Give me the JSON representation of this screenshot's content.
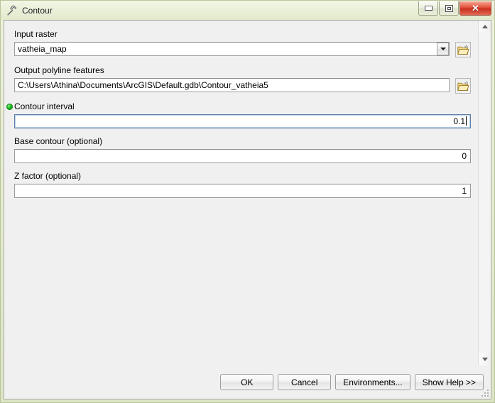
{
  "window": {
    "title": "Contour",
    "title_icon": "hammer-tool-icon",
    "controls": {
      "minimize": "minimize-icon",
      "restore": "restore-icon",
      "close": "✕"
    }
  },
  "form": {
    "fields": [
      {
        "label": "Input raster",
        "value": "vatheia_map",
        "type": "combo",
        "required": false,
        "align": "left",
        "has_browse": true,
        "focused": false
      },
      {
        "label": "Output polyline features",
        "value": "C:\\Users\\Athina\\Documents\\ArcGIS\\Default.gdb\\Contour_vatheia5",
        "type": "text",
        "required": false,
        "align": "left",
        "has_browse": true,
        "focused": false
      },
      {
        "label": "Contour interval",
        "value": "0.1",
        "type": "text",
        "required": true,
        "align": "right",
        "has_browse": false,
        "focused": true
      },
      {
        "label": "Base contour (optional)",
        "value": "0",
        "type": "text",
        "required": false,
        "align": "right",
        "has_browse": false,
        "focused": false
      },
      {
        "label": "Z factor (optional)",
        "value": "1",
        "type": "text",
        "required": false,
        "align": "right",
        "has_browse": false,
        "focused": false
      }
    ]
  },
  "scrollbar": {
    "up_icon": "scroll-up-arrow-icon",
    "down_icon": "scroll-down-arrow-icon"
  },
  "footer": {
    "buttons": [
      {
        "label": "OK"
      },
      {
        "label": "Cancel"
      },
      {
        "label": "Environments..."
      },
      {
        "label": "Show Help >>"
      }
    ]
  },
  "colors": {
    "frame": "#dfe6c8",
    "client_bg": "#f0f0f0",
    "required_dot": "#22c021",
    "close_button": "#c9301c",
    "focus_border": "#5a7fa8"
  }
}
